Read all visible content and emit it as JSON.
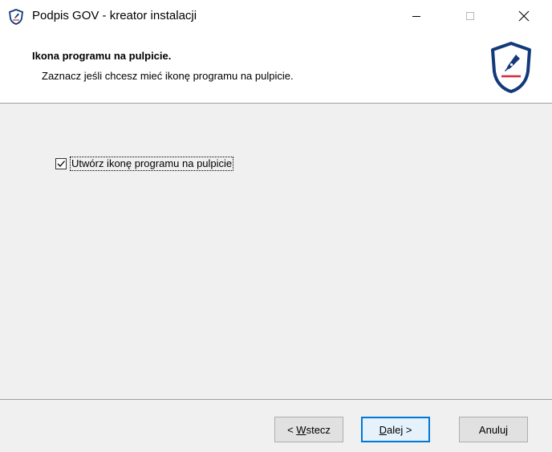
{
  "window": {
    "title": "Podpis GOV - kreator instalacji"
  },
  "header": {
    "title": "Ikona programu na pulpicie.",
    "subtitle": "Zaznacz jeśli chcesz mieć ikonę programu na pulpicie."
  },
  "options": {
    "desktop_icon_label": "Utwórz ikonę programu na pulpicie",
    "desktop_icon_checked": true
  },
  "buttons": {
    "back_prefix": "< ",
    "back_accel": "W",
    "back_rest": "stecz",
    "next_accel": "D",
    "next_rest": "alej >",
    "cancel": "Anuluj"
  },
  "colors": {
    "brand_blue": "#123a7a",
    "brand_red": "#d6293a",
    "focus_blue": "#0078d7"
  }
}
